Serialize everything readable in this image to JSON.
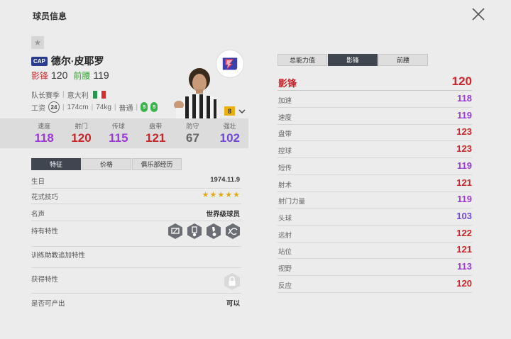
{
  "title": "球员信息",
  "player": {
    "card_tag": "CAP",
    "name": "德尔·皮耶罗",
    "main_pos_label": "影锋",
    "main_pos_value": "120",
    "sec_pos_label": "前腰",
    "sec_pos_value": "119",
    "season": "队长赛季",
    "nationality": "意大利",
    "salary_label": "工资",
    "salary": "24",
    "height": "174cm",
    "weight": "74kg",
    "body_type": "普通",
    "weak_foot_left": "5",
    "weak_foot_right": "5",
    "level": "8"
  },
  "stats": [
    {
      "label": "速度",
      "value": "118",
      "color": "#9b39d6"
    },
    {
      "label": "射门",
      "value": "120",
      "color": "#c8262a"
    },
    {
      "label": "传球",
      "value": "115",
      "color": "#9b39d6"
    },
    {
      "label": "盘带",
      "value": "121",
      "color": "#c8262a"
    },
    {
      "label": "防守",
      "value": "67",
      "color": "#666666"
    },
    {
      "label": "强壮",
      "value": "102",
      "color": "#7248d8"
    }
  ],
  "left_tabs": [
    "特征",
    "价格",
    "俱乐部经历"
  ],
  "info": {
    "birthday_label": "生日",
    "birthday": "1974.11.9",
    "skill_label": "花式技巧",
    "skill_stars": 5,
    "fame_label": "名声",
    "fame": "世界级球员",
    "traits_label": "持有特性",
    "trainer_label": "训练助教追加特性",
    "acquired_label": "获得特性",
    "producible_label": "是否可产出",
    "producible": "可以"
  },
  "right_tabs": [
    "总能力值",
    "影锋",
    "前腰"
  ],
  "position_header": {
    "label": "影锋",
    "value": "120"
  },
  "attributes": [
    {
      "label": "加速",
      "value": "118",
      "color": "#9b39d6"
    },
    {
      "label": "速度",
      "value": "119",
      "color": "#9b39d6"
    },
    {
      "label": "盘带",
      "value": "123",
      "color": "#c8262a"
    },
    {
      "label": "控球",
      "value": "123",
      "color": "#c8262a"
    },
    {
      "label": "短传",
      "value": "119",
      "color": "#9b39d6"
    },
    {
      "label": "射术",
      "value": "121",
      "color": "#c8262a"
    },
    {
      "label": "射门力量",
      "value": "119",
      "color": "#9b39d6"
    },
    {
      "label": "头球",
      "value": "103",
      "color": "#7248d8"
    },
    {
      "label": "远射",
      "value": "122",
      "color": "#c8262a"
    },
    {
      "label": "站位",
      "value": "121",
      "color": "#c8262a"
    },
    {
      "label": "视野",
      "value": "113",
      "color": "#9b39d6"
    },
    {
      "label": "反应",
      "value": "120",
      "color": "#c8262a"
    }
  ],
  "icons": {
    "close": "close-icon",
    "favorite": "star-icon",
    "team": "lightning-badge-icon",
    "lock": "lock-icon"
  }
}
